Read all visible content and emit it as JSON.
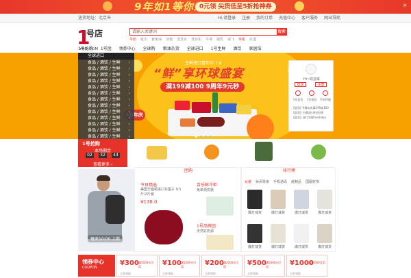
{
  "promo": {
    "headline": "9年如1等你来",
    "pill": "0元领 尖货低至5折抢神券",
    "tag": "7.13-7.15"
  },
  "topbar": {
    "location": "送货地址：北京市",
    "links": [
      "Hi,请登录",
      "注册",
      "我的订单",
      "充值中心",
      "客户服务",
      "网站导航"
    ]
  },
  "logo": {
    "mark": "1",
    "name": "号店",
    "domain": "YHD.COM"
  },
  "search": {
    "placeholder": "请输入关键词",
    "button": "搜索",
    "hot": [
      "牛奶",
      "纸巾",
      "食用油",
      "冰箱",
      "洗发水",
      "洗衣机",
      "牛排",
      "酸乳",
      "威飞",
      "手机",
      "红酒"
    ]
  },
  "nav": [
    "1号抢购",
    "1号团",
    "领券中心",
    "全球购",
    "粮油杂货",
    "全球进口",
    "1号生鲜",
    "酒饮",
    "家居馆"
  ],
  "sidebar": {
    "title": "全球进口",
    "rows": [
      "食品 / 酒饮 / 生鲜",
      "食品 / 酒饮 / 生鲜",
      "食品 / 酒饮 / 生鲜",
      "食品 / 酒饮 / 生鲜",
      "食品 / 酒饮 / 生鲜",
      "食品 / 酒饮 / 生鲜",
      "食品 / 酒饮 / 生鲜",
      "食品 / 酒饮 / 生鲜",
      "食品 / 酒饮 / 生鲜",
      "食品 / 酒饮 / 生鲜",
      "食品 / 酒饮 / 生鲜",
      "食品 / 酒饮 / 生鲜",
      "食品 / 酒饮 / 生鲜"
    ]
  },
  "banner": {
    "sub": "生鲜进口嘉年华 7.6",
    "badge": "9周年庆",
    "headline": "“鲜”享环球盛宴",
    "offer": "满199减100 9周年9元秒"
  },
  "user": {
    "greeting": "Hi~欢迎来",
    "login": "登录",
    "register": "注册",
    "icons": [
      "1号会员",
      "1号钱包",
      "手机代理"
    ],
    "lines": [
      "【会员】9周年庆满199减100",
      "【会员】白俄进口9元秒杀",
      "【会员】进口生鲜Freshday"
    ]
  },
  "sale": {
    "title": "1号抢购",
    "subtitle": "本场剩余",
    "hh": "02",
    "mm": "32",
    "ss": "44",
    "more": "查看更多 ›"
  },
  "tuan": {
    "title": "团购",
    "item1": {
      "title": "今日精选",
      "desc": "美国华盛顿进口车厘子 9.5斤/2斤装",
      "price": "¥138.0"
    },
    "item2": {
      "title": "百乐鲜冷柜",
      "desc": "免单领优惠"
    },
    "item3": {
      "title": "1号品牌团",
      "desc": "天然好奶源"
    }
  },
  "rank": {
    "title": "排行榜",
    "tabs": [
      "女装",
      "休闲零食",
      "手机通讯",
      "纸制品",
      "国服好货"
    ],
    "labels": [
      "爆灯减货",
      "爆灯减货",
      "爆灯减货",
      "爆灯减货",
      "爆灯减货",
      "爆灯减货",
      "爆灯减货",
      "爆灯减货"
    ]
  },
  "leftimg": {
    "caption": "每天10:00 上新"
  },
  "coupons": {
    "title": "领券中心",
    "en": "COUPON",
    "items": [
      {
        "v": "¥300",
        "d": "满3000元可用",
        "d2": "立即领取"
      },
      {
        "v": "¥100",
        "d": "满1000元可用",
        "d2": "立即领取"
      },
      {
        "v": "¥200",
        "d": "满2000元可用",
        "d2": "立即领取"
      },
      {
        "v": "¥500",
        "d": "满5000元可用",
        "d2": "立即领取"
      },
      {
        "v": "¥1000",
        "d": "满10000可用",
        "d2": "立即领取"
      }
    ]
  }
}
